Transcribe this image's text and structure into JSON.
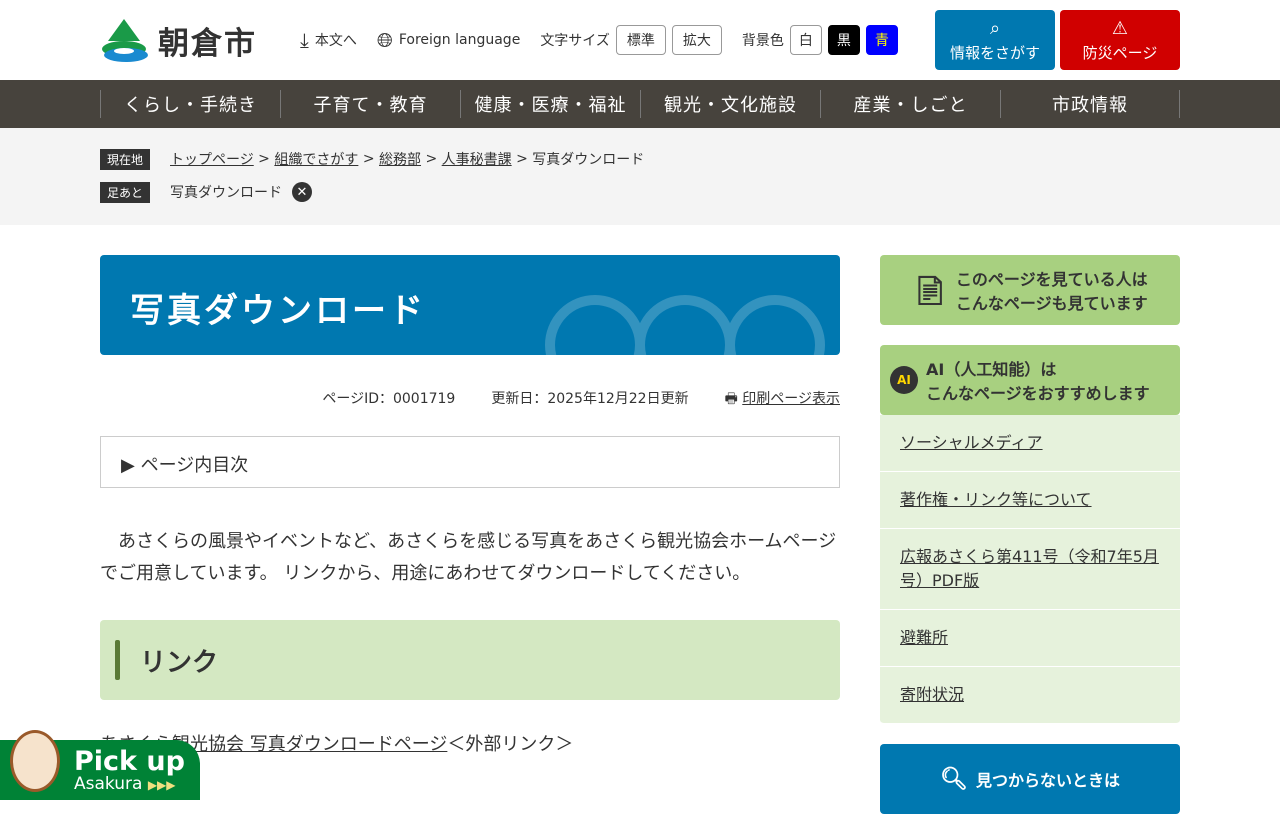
{
  "header": {
    "logo_text": "朝倉市",
    "skip": "本文へ",
    "foreign": "Foreign language",
    "font_size_label": "文字サイズ",
    "font_normal": "標準",
    "font_large": "拡大",
    "bg_label": "背景色",
    "bg_white": "白",
    "bg_black": "黒",
    "bg_blue": "青",
    "search_btn": "情報をさがす",
    "disaster_btn": "防災ページ"
  },
  "nav": [
    "くらし・手続き",
    "子育て・教育",
    "健康・医療・福祉",
    "観光・文化施設",
    "産業・しごと",
    "市政情報"
  ],
  "breadcrumb": {
    "tag": "現在地",
    "items": [
      "トップページ",
      "組織でさがす",
      "総務部",
      "人事秘書課"
    ],
    "current": "写真ダウンロード",
    "history_tag": "足あと",
    "history": "写真ダウンロード"
  },
  "main": {
    "title": "写真ダウンロード",
    "page_id": "ページID：0001719",
    "updated": "更新日：2025年12月22日更新",
    "print": "印刷ページ表示",
    "toc": "ページ内目次",
    "body": "あさくらの風景やイベントなど、あさくらを感じる写真をあさくら観光協会ホームページでご用意しています。 リンクから、用途にあわせてダウンロードしてください。",
    "h2": "リンク",
    "link": "あさくら観光協会 写真ダウンロードページ",
    "ext": "＜外部リンク＞"
  },
  "side": {
    "viewed1": "このページを見ている人は",
    "viewed2": "こんなページも見ています",
    "ai1": "AI（人工知能）は",
    "ai2": "こんなページをおすすめします",
    "links": [
      "ソーシャルメディア",
      "著作権・リンク等について",
      "広報あさくら第411号（令和7年5月号）PDF版",
      "避難所",
      "寄附状況"
    ],
    "notfound": "見つからないときは"
  },
  "pickup": {
    "title": "Pick up",
    "sub": "Asakura"
  }
}
